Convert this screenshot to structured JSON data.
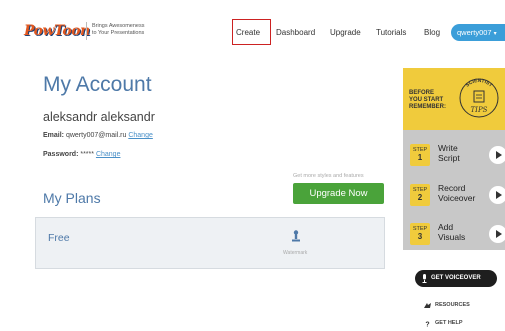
{
  "header": {
    "logo_text": "PowToon",
    "tagline_line1": "Brings Awesomeness",
    "tagline_line2": "to Your Presentations",
    "nav": {
      "create": "Create",
      "dashboard": "Dashboard",
      "upgrade": "Upgrade",
      "tutorials": "Tutorials",
      "blog": "Blog"
    },
    "user_menu": "qwerty007"
  },
  "account": {
    "title": "My Account",
    "full_name": "aleksandr aleksandr",
    "email_label": "Email:",
    "email_value": "qwerty007@mail.ru",
    "email_change": "Change",
    "password_label": "Password:",
    "password_value": "*****",
    "password_change": "Change"
  },
  "plans": {
    "title": "My Plans",
    "upgrade_hint": "Get more styles and features",
    "upgrade_button": "Upgrade Now",
    "current_plan": "Free",
    "watermark_label": "Watermark"
  },
  "tips": {
    "head_line1": "BEFORE",
    "head_line2": "YOU START",
    "head_line3": "REMEMBER:",
    "badge_top": "SCIENTIST",
    "badge_bottom": "TIPS",
    "steps": [
      {
        "tag": "STEP",
        "num": "1",
        "line1": "Write",
        "line2": "Script"
      },
      {
        "tag": "STEP",
        "num": "2",
        "line1": "Record",
        "line2": "Voiceover"
      },
      {
        "tag": "STEP",
        "num": "3",
        "line1": "Add",
        "line2": "Visuals"
      }
    ]
  },
  "sidebar": {
    "voiceover_button": "GET VOICEOVER",
    "resources": "RESOURCES",
    "help": "GET HELP"
  },
  "colors": {
    "accent_blue": "#3b9ed9",
    "title_blue": "#4e79a8",
    "upgrade_green": "#4aa33a",
    "tips_yellow": "#f0cb3c",
    "highlight_red": "#cc2222"
  }
}
